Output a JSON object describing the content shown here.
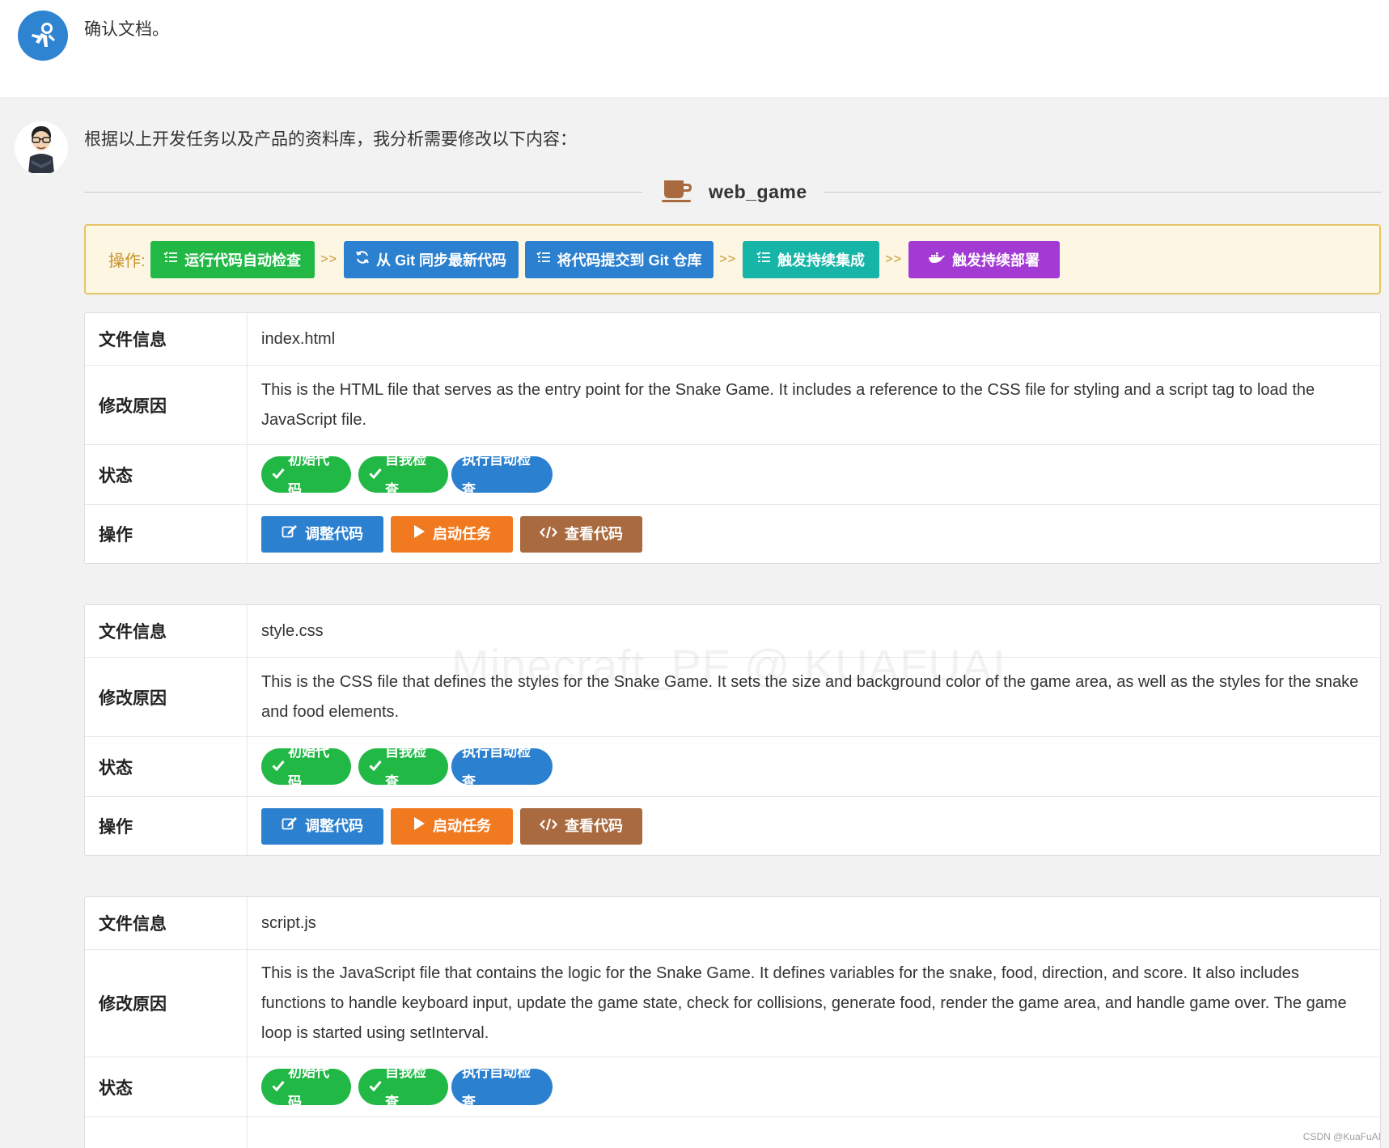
{
  "user_message": {
    "text": "确认文档。"
  },
  "bot_message": {
    "intro": "根据以上开发任务以及产品的资料库，我分析需要修改以下内容：",
    "project_name": "web_game",
    "ops_bar": {
      "label": "操作:",
      "separator": ">>",
      "buttons": [
        {
          "label": "运行代码自动检查",
          "icon": "list-check-icon",
          "color": "#22b846"
        },
        {
          "label": "从 Git 同步最新代码",
          "icon": "sync-icon",
          "color": "#2b80d0"
        },
        {
          "label": "将代码提交到 Git 仓库",
          "icon": "list-check-icon",
          "color": "#2b80d0"
        },
        {
          "label": "触发持续集成",
          "icon": "list-check-icon",
          "color": "#17b5a7"
        },
        {
          "label": "触发持续部署",
          "icon": "docker-icon",
          "color": "#a43ad4"
        }
      ]
    },
    "row_labels": {
      "file_info": "文件信息",
      "reason": "修改原因",
      "status": "状态",
      "actions": "操作"
    },
    "status_badges": {
      "initial_code": "初始代码",
      "self_check": "自我检查",
      "run_auto_check": "执行自动检查"
    },
    "action_buttons": {
      "adjust_code": "调整代码",
      "start_task": "启动任务",
      "view_code": "查看代码"
    },
    "files": [
      {
        "name": "index.html",
        "reason": "This is the HTML file that serves as the entry point for the Snake Game. It includes a reference to the CSS file for styling and a script tag to load the JavaScript file."
      },
      {
        "name": "style.css",
        "reason": "This is the CSS file that defines the styles for the Snake Game. It sets the size and background color of the game area, as well as the styles for the snake and food elements."
      },
      {
        "name": "script.js",
        "reason": "This is the JavaScript file that contains the logic for the Snake Game. It defines variables for the snake, food, direction, and score. It also includes functions to handle keyboard input, update the game state, check for collisions, generate food, render the game area, and handle game over. The game loop is started using setInterval."
      }
    ]
  },
  "watermark": "Minecraft_PF @ KUAFUAI",
  "footer_credit": "CSDN @KuaFuAI",
  "colors": {
    "green": "#22b846",
    "blue": "#2b80d0",
    "teal": "#17b5a7",
    "purple": "#a43ad4",
    "orange": "#f17a20",
    "brown": "#a86a3e",
    "ops_bg": "#fcf6e2",
    "ops_border": "#e6c566"
  }
}
